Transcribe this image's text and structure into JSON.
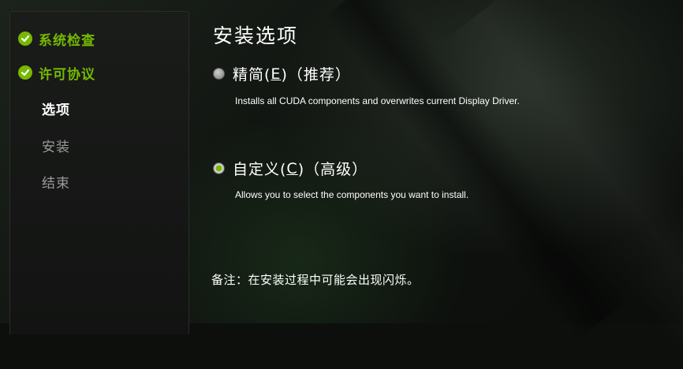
{
  "sidebar": {
    "items": [
      {
        "label": "系统检查",
        "state": "done"
      },
      {
        "label": "许可协议",
        "state": "done"
      },
      {
        "label": "选项",
        "state": "current"
      },
      {
        "label": "安装",
        "state": "pending"
      },
      {
        "label": "结束",
        "state": "pending"
      }
    ]
  },
  "main": {
    "title": "安装选项",
    "options": [
      {
        "label_pre": "精简(",
        "mnemonic": "E",
        "label_post": ")（推荐）",
        "description": "Installs all CUDA components and overwrites current Display Driver.",
        "selected": false
      },
      {
        "label_pre": "自定义(",
        "mnemonic": "C",
        "label_post": ")（高级）",
        "description": "Allows you to select the components you want to install.",
        "selected": true
      }
    ],
    "note": "备注：在安装过程中可能会出现闪烁。"
  },
  "colors": {
    "accent": "#76b900",
    "text": "#ffffff",
    "muted": "#9a9a9a"
  }
}
